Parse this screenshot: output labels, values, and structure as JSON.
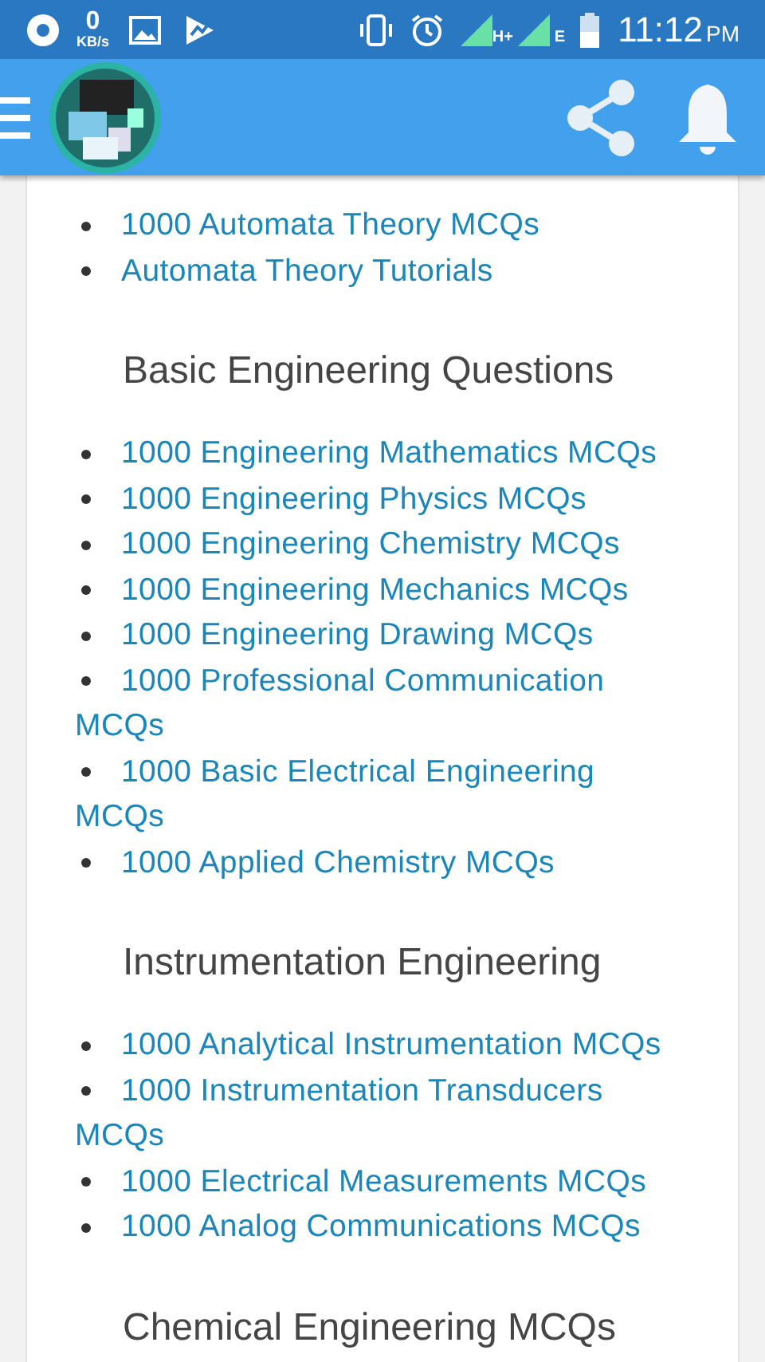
{
  "status_bar": {
    "network_speed": "0",
    "network_speed_unit": "KB/s",
    "network_type_1": "H+",
    "network_type_2": "E",
    "time": "11:12",
    "time_suffix": "PM"
  },
  "sections": [
    {
      "items": [
        "1000 Automata Theory MCQs",
        "Automata Theory Tutorials"
      ]
    },
    {
      "heading": "Basic Engineering Questions",
      "items": [
        "1000 Engineering Mathematics MCQs",
        "1000 Engineering Physics MCQs",
        "1000 Engineering Chemistry MCQs",
        "1000 Engineering Mechanics MCQs",
        "1000 Engineering Drawing MCQs",
        "1000 Professional Communication MCQs",
        "1000 Basic Electrical Engineering MCQs",
        "1000 Applied Chemistry MCQs"
      ]
    },
    {
      "heading": "Instrumentation Engineering",
      "items": [
        "1000 Analytical Instrumentation MCQs",
        "1000 Instrumentation Transducers MCQs",
        "1000 Electrical Measurements MCQs",
        "1000 Analog Communications MCQs"
      ]
    },
    {
      "heading": "Chemical Engineering MCQs"
    }
  ]
}
